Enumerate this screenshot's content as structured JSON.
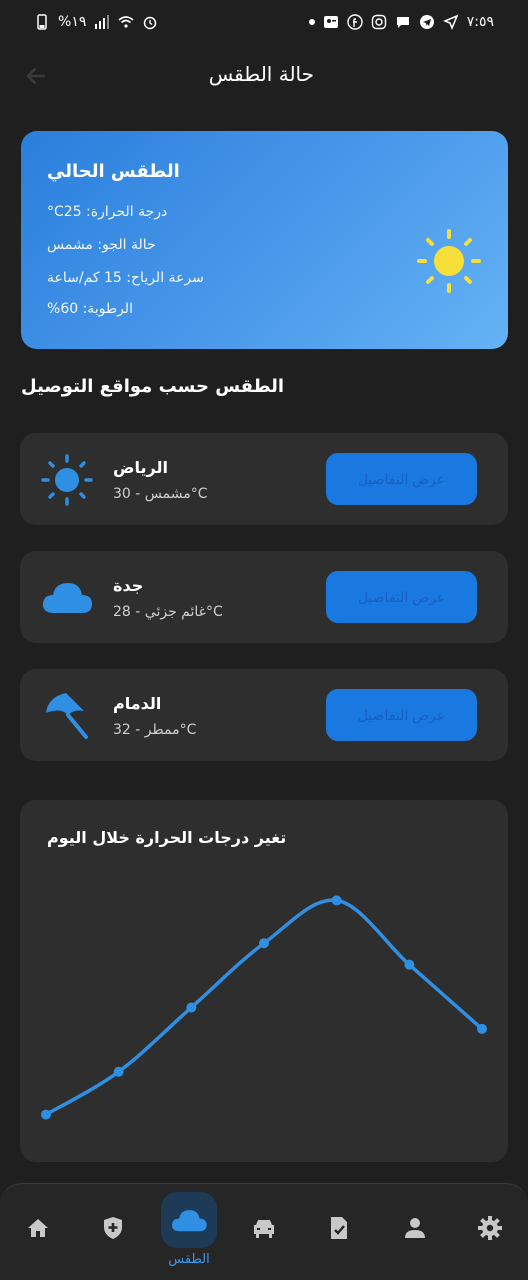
{
  "status_bar": {
    "battery": "%١٩",
    "time": "٧:٥٩"
  },
  "app_bar": {
    "title": "حالة الطقس"
  },
  "current_weather": {
    "title": "الطقس الحالي",
    "temperature_line": "°Cدرجة الحرارة: 25",
    "condition_line": "حالة الجو: مشمس",
    "wind_line": "سرعة الرياح: 15 كم/ساعة",
    "humidity_line": "%الرطوبة: 60",
    "icon": "sun-icon"
  },
  "locations_section": {
    "title": "الطقس حسب مواقع التوصيل",
    "items": [
      {
        "name": "الرياض",
        "desc": "مشمس - 30°C",
        "icon": "sun-icon",
        "button": "عرض التفاصيل"
      },
      {
        "name": "جدة",
        "desc": "غائم جزئي - 28°C",
        "icon": "cloud-icon",
        "button": "عرض التفاصيل"
      },
      {
        "name": "الدمام",
        "desc": "ممطر - 32°C",
        "icon": "umbrella-icon",
        "button": "عرض التفاصيل"
      }
    ]
  },
  "chart_section": {
    "title": "تغير درجات الحرارة خلال اليوم"
  },
  "chart_data": {
    "type": "line",
    "title": "تغير درجات الحرارة خلال اليوم",
    "xlabel": "",
    "ylabel": "",
    "x": [
      0,
      1,
      2,
      3,
      4,
      5,
      6
    ],
    "values": [
      22,
      24,
      27,
      30,
      32,
      29,
      26
    ],
    "ylim": [
      21,
      33
    ],
    "grid": false,
    "color": "#2f8fe3"
  },
  "bottom_nav": {
    "items": [
      {
        "name": "home",
        "icon": "home-icon"
      },
      {
        "name": "shield",
        "icon": "shield-plus-icon"
      },
      {
        "name": "weather",
        "icon": "cloud-icon",
        "label": "الطقس",
        "active": true
      },
      {
        "name": "vehicle",
        "icon": "car-icon"
      },
      {
        "name": "documents",
        "icon": "document-check-icon"
      },
      {
        "name": "profile",
        "icon": "person-icon"
      },
      {
        "name": "settings",
        "icon": "gear-icon"
      }
    ]
  },
  "colors": {
    "accent": "#1a79e0",
    "card": "#2e2e2e",
    "background": "#1f1f1f",
    "sun": "#f7df3a",
    "icon_blue": "#2f8fe3"
  }
}
